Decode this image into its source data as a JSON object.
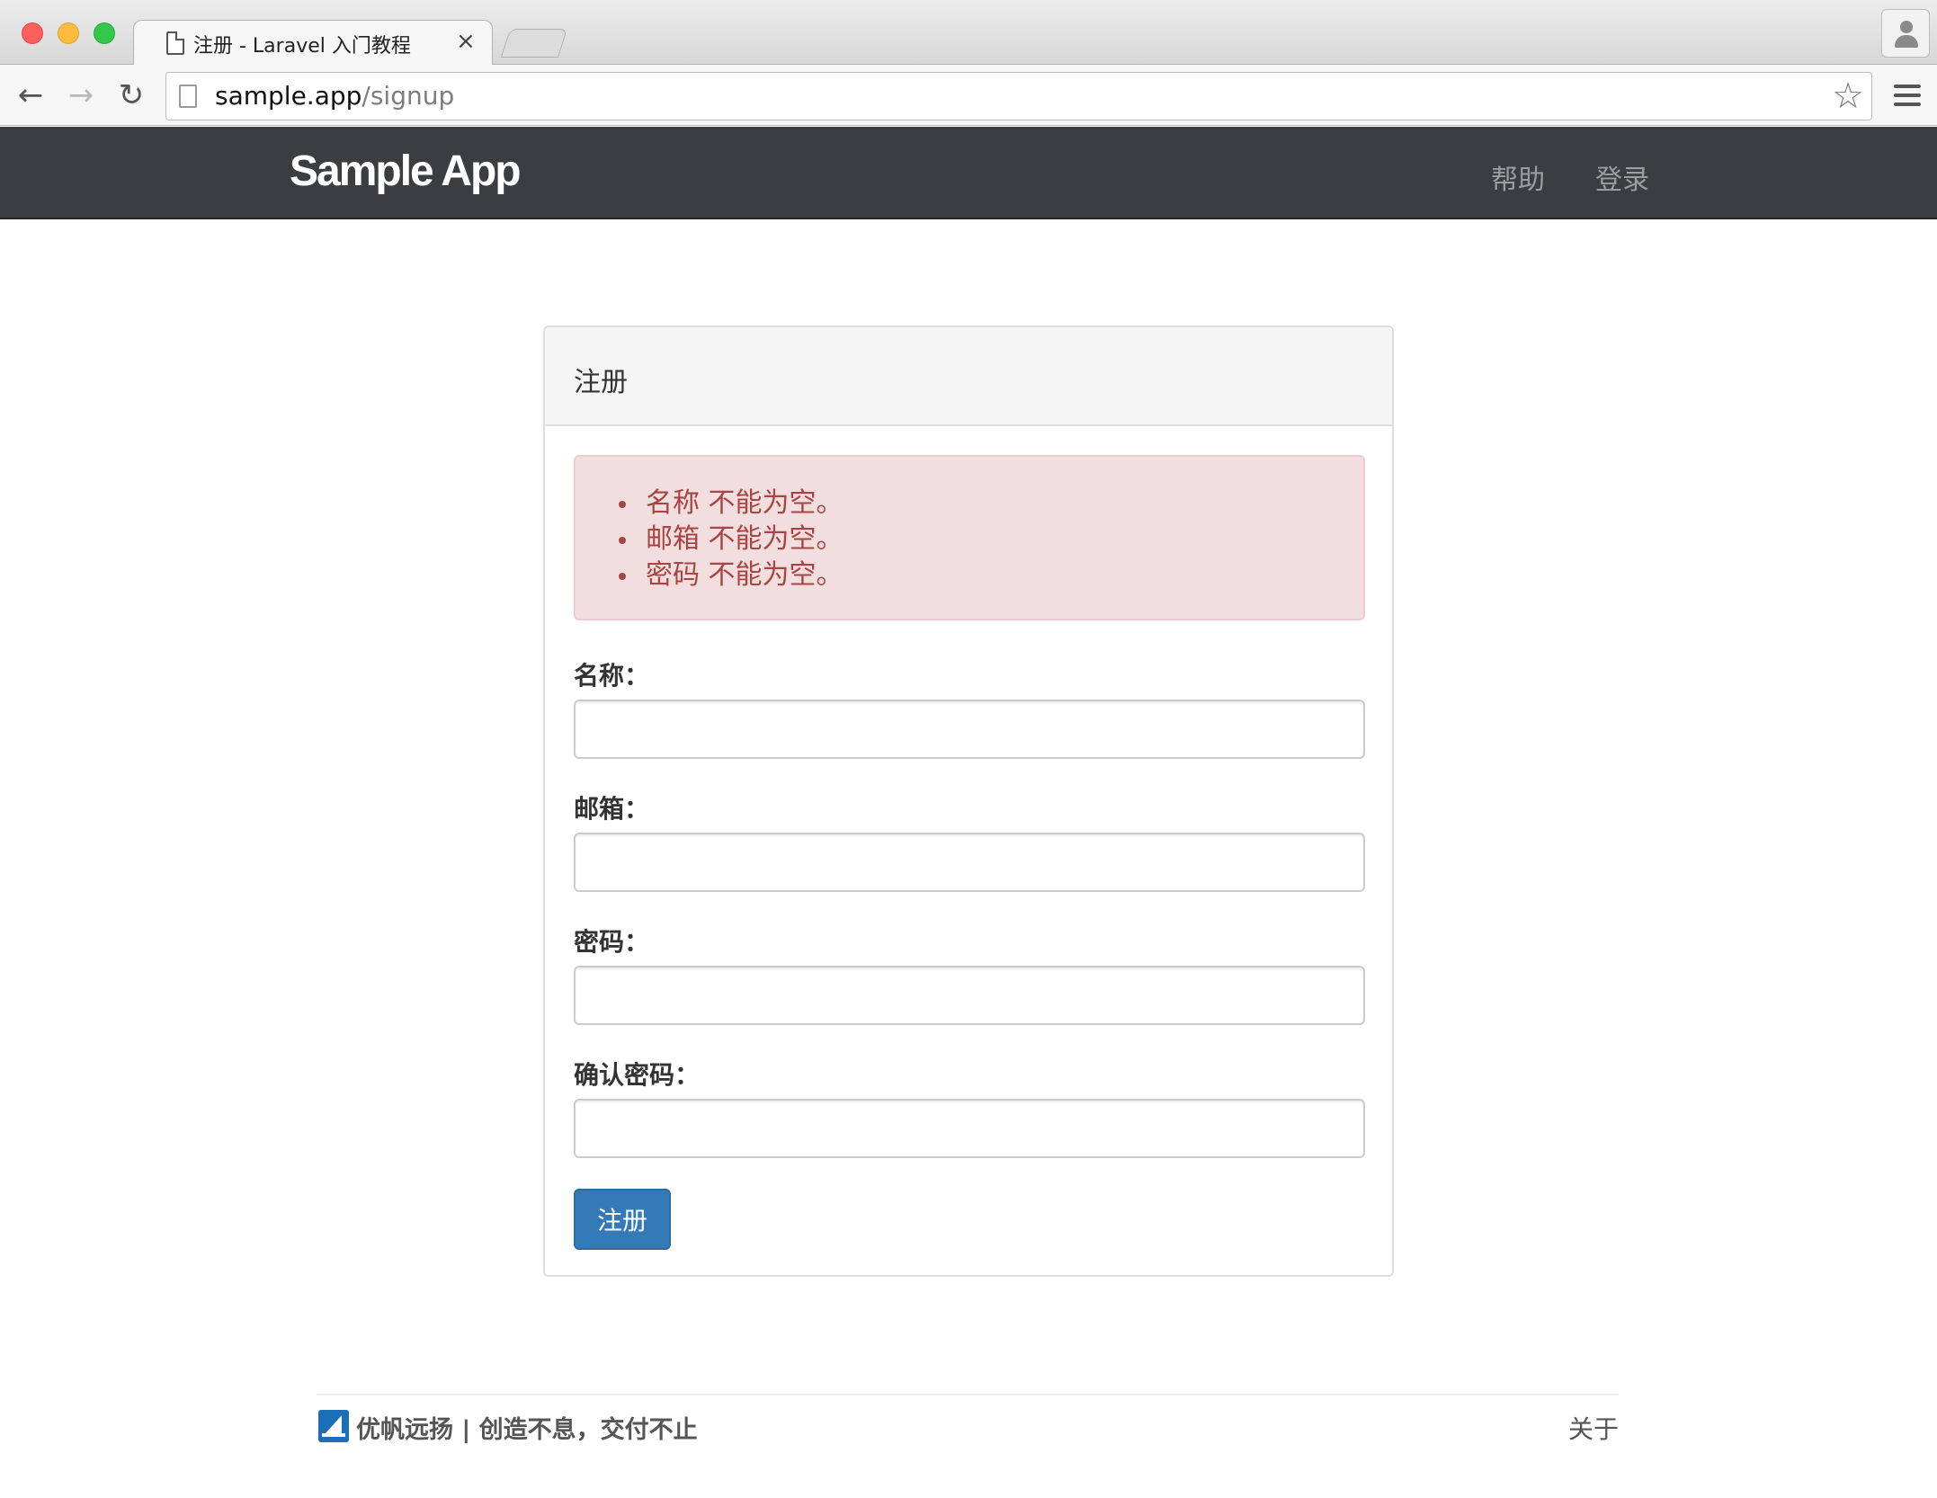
{
  "browser": {
    "tab_title": "注册 - Laravel 入门教程",
    "tab_close": "×",
    "url_host": "sample.app",
    "url_path": "/signup",
    "icons": {
      "back": "arrow-left-icon",
      "forward": "arrow-right-icon",
      "reload": "reload-icon",
      "star": "star-icon",
      "menu": "hamburger-menu-icon",
      "profile": "user-profile-icon"
    }
  },
  "navbar": {
    "brand": "Sample App",
    "links": [
      "帮助",
      "登录"
    ],
    "background": "#3c3d41"
  },
  "panel": {
    "title": "注册",
    "errors": [
      "名称 不能为空。",
      "邮箱 不能为空。",
      "密码 不能为空。"
    ],
    "fields": [
      {
        "label": "名称：",
        "value": ""
      },
      {
        "label": "邮箱：",
        "value": ""
      },
      {
        "label": "密码：",
        "value": ""
      },
      {
        "label": "确认密码：",
        "value": ""
      }
    ],
    "submit_label": "注册",
    "colors": {
      "error_bg": "#f2dede",
      "error_text": "#a94442",
      "primary": "#337ab7"
    }
  },
  "footer": {
    "brand_text": "优帆远扬 | 创造不息，交付不止",
    "about": "关于"
  }
}
